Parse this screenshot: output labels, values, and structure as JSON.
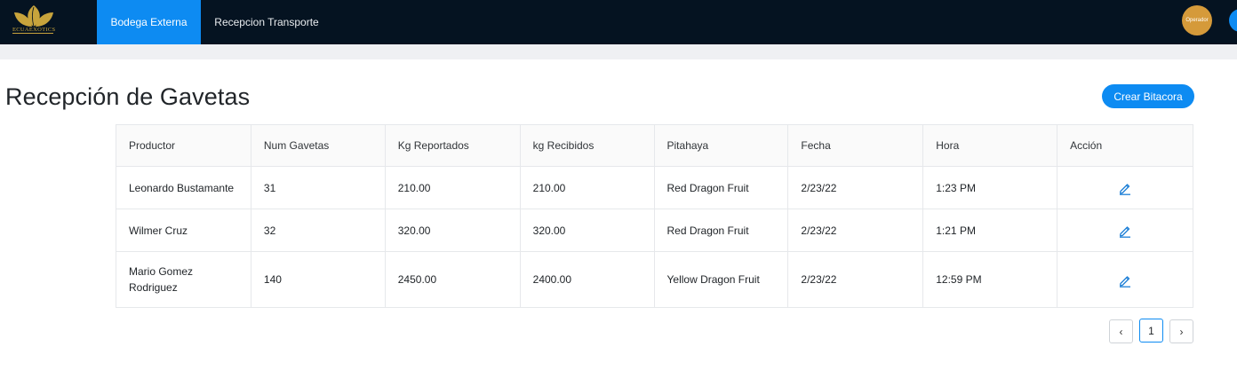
{
  "nav": {
    "logo_text": "ECUAEXOTICS",
    "tabs": [
      {
        "label": "Bodega Externa",
        "active": true
      },
      {
        "label": "Recepcion Transporte",
        "active": false
      }
    ],
    "avatar_label": "Operador"
  },
  "page": {
    "title": "Recepción de Gavetas",
    "create_button": "Crear Bitacora"
  },
  "table": {
    "headers": [
      "Productor",
      "Num Gavetas",
      "Kg Reportados",
      "kg Recibidos",
      "Pitahaya",
      "Fecha",
      "Hora",
      "Acción"
    ],
    "rows": [
      {
        "productor": "Leonardo Bustamante",
        "num_gavetas": "31",
        "kg_reportados": "210.00",
        "kg_recibidos": "210.00",
        "pitahaya": "Red Dragon Fruit",
        "fecha": "2/23/22",
        "hora": "1:23 PM"
      },
      {
        "productor": "Wilmer Cruz",
        "num_gavetas": "32",
        "kg_reportados": "320.00",
        "kg_recibidos": "320.00",
        "pitahaya": "Red Dragon Fruit",
        "fecha": "2/23/22",
        "hora": "1:21 PM"
      },
      {
        "productor": "Mario Gomez Rodriguez",
        "num_gavetas": "140",
        "kg_reportados": "2450.00",
        "kg_recibidos": "2400.00",
        "pitahaya": "Yellow Dragon Fruit",
        "fecha": "2/23/22",
        "hora": "12:59 PM"
      }
    ],
    "action_icon": "edit-icon"
  },
  "pagination": {
    "prev": "‹",
    "current": "1",
    "next": "›"
  },
  "colors": {
    "navbar": "#051321",
    "accent": "#0d8bf2",
    "avatar": "#d59a3a",
    "logo_gold": "#c8a43c"
  }
}
